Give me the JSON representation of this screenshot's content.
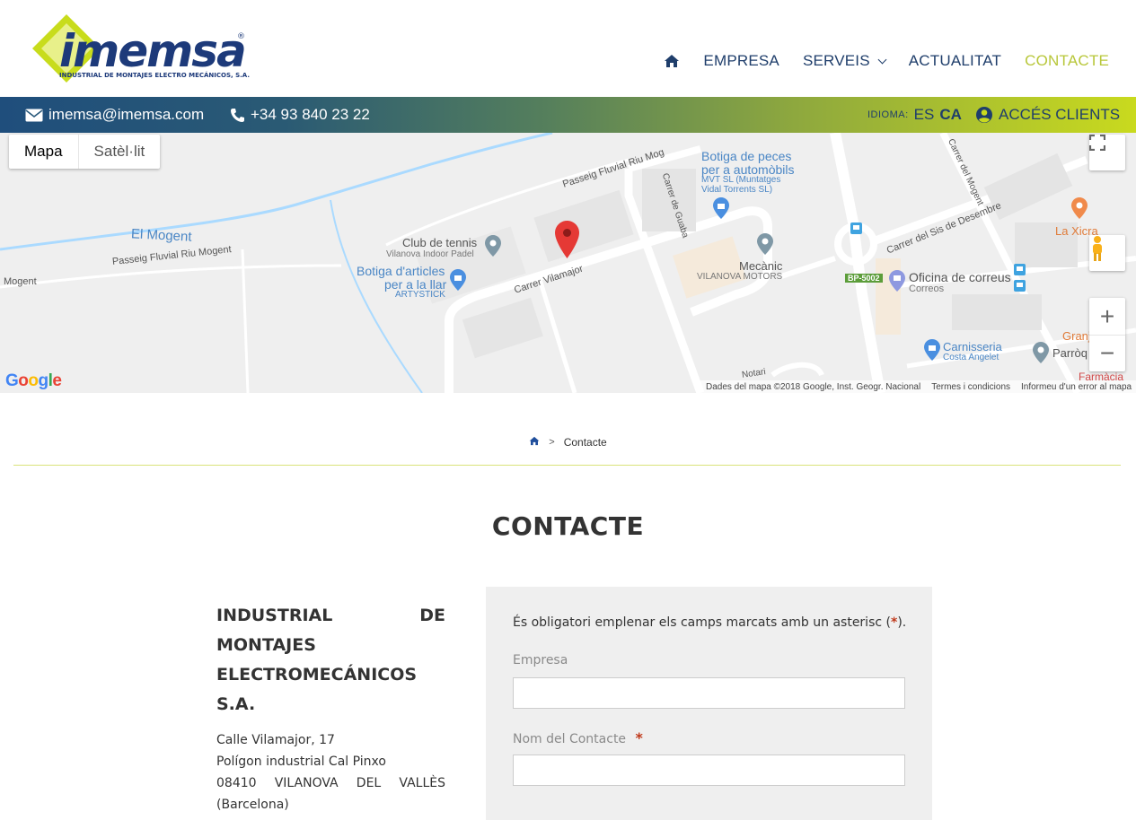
{
  "brand": {
    "logo_text": "imemsa",
    "logo_reg": "®",
    "logo_sub": "INDUSTRIAL DE MONTAJES ELECTRO MECÁNICOS, S.A."
  },
  "nav": {
    "items": [
      {
        "label": "EMPRESA"
      },
      {
        "label": "SERVEIS"
      },
      {
        "label": "ACTUALITAT"
      },
      {
        "label": "CONTACTE"
      }
    ]
  },
  "topbar": {
    "email": "imemsa@imemsa.com",
    "phone": "+34 93 840 23 22",
    "language_label": "IDIOMA:",
    "lang_es": "ES",
    "lang_ca": "CA",
    "access": "ACCÉS CLIENTS"
  },
  "map": {
    "toggle_map": "Mapa",
    "toggle_sat": "Satèl·lit",
    "zoom_in": "+",
    "zoom_out": "−",
    "google": "Google",
    "footer_data": "Dades del mapa ©2018 Google, Inst. Geogr. Nacional",
    "footer_terms": "Termes i condicions",
    "footer_report": "Informeu d'un error al mapa",
    "labels": {
      "mogent_river": "El Mogent",
      "mogent_left": "Mogent",
      "passeig1": "Passeig Fluvial Riu Mogent",
      "passeig2": "Passeig Fluvial Riu Mog",
      "club_tennis": "Club de tennis",
      "club_tennis_sub": "Vilanova Indoor Padel",
      "botiga_llar1": "Botiga d'articles",
      "botiga_llar2": "per a la llar",
      "botiga_llar_sub": "ARTYSTICK",
      "carrer_vilamajor": "Carrer Vilamajor",
      "carrer_guaba": "Carrer de Guaba",
      "botiga_peces1": "Botiga de peces",
      "botiga_peces2": "per a automòbils",
      "botiga_peces_sub1": "MVT SL (Muntatges",
      "botiga_peces_sub2": "Vidal Torrents SL)",
      "mecanic": "Mecànic",
      "mecanic_sub": "VILANOVA MOTORS",
      "carrer_sis": "Carrer del Sis de Desembre",
      "carrer_mogent": "Carrer del Mogent",
      "la_xicra": "La Xicra",
      "bp_road": "BP-5002",
      "oficina": "Oficina de correus",
      "oficina_sub": "Correos",
      "carnisseria": "Carnisseria",
      "carnisseria_sub": "Costa Angelet",
      "parroquia": "Parròq",
      "granja": "Granj",
      "farmacia": "Farmàcia",
      "notari": "Notari"
    },
    "colors": {
      "pin": "#e53935",
      "water": "#aadaff",
      "road": "#ffffff",
      "land": "#efefef",
      "poi_blue": "#4a8fe0",
      "poi_gray": "#7f98a6"
    }
  },
  "breadcrumb": {
    "separator": ">",
    "current": "Contacte"
  },
  "page": {
    "title": "CONTACTE"
  },
  "company": {
    "name_lines": [
      "INDUSTRIAL DE",
      "MONTAJES",
      "ELECTROMECÁNICOS",
      "S.A."
    ],
    "address_lines": [
      "Calle Vilamajor, 17",
      "Polígon industrial Cal Pinxo",
      "08410 VILANOVA DEL VALLÈS",
      "(Barcelona)"
    ]
  },
  "form": {
    "note_prefix": "És obligatori emplenar els camps marcats amb un asterisc (",
    "note_star": "*",
    "note_suffix": ").",
    "fields": [
      {
        "label": "Empresa",
        "required": false,
        "value": ""
      },
      {
        "label": "Nom del Contacte",
        "required": true,
        "value": ""
      }
    ],
    "required_star": "*"
  }
}
